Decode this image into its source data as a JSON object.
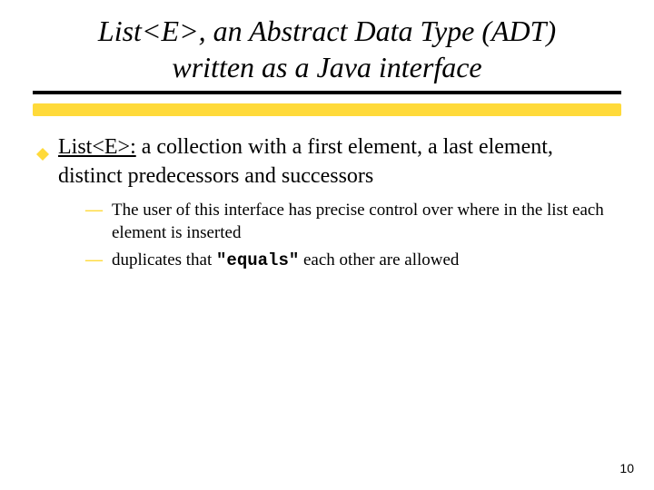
{
  "title": {
    "line1": "List<E>, an Abstract Data Type (ADT)",
    "line2": "written as a Java interface"
  },
  "main_point": {
    "term": "List<E>:",
    "definition_rest": " a collection with a first element, a last element, distinct predecessors and successors"
  },
  "sub_points": [
    {
      "text": "The user of this interface has precise control over where in the list each element is inserted"
    },
    {
      "prefix": "duplicates that ",
      "code": "\"equals\"",
      "suffix": " each other are allowed"
    }
  ],
  "page_number": "10"
}
